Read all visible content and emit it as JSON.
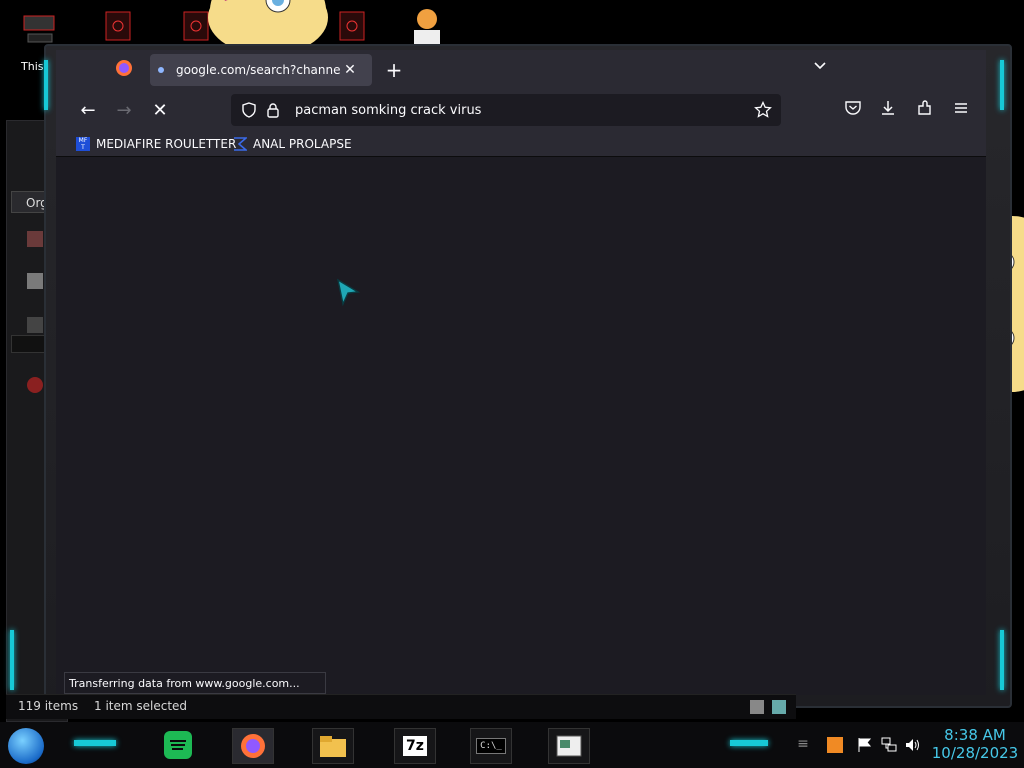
{
  "desktop": {
    "icon_label": "This"
  },
  "browser": {
    "tab": {
      "title": "google.com/search?channel=fs",
      "close_glyph": "✕"
    },
    "newtab_glyph": "+",
    "tablist_glyph": "⌄",
    "nav": {
      "back_glyph": "←",
      "forward_glyph": "→",
      "stop_glyph": "✕"
    },
    "url": "pacman somking crack virus",
    "toolbar_icons": [
      "star-icon",
      "pocket-icon",
      "download-icon",
      "extensions-icon",
      "menu-icon"
    ],
    "bookmarks": [
      {
        "label": "MEDIAFIRE ROULETTER",
        "icon": "MF T"
      },
      {
        "label": "ANAL PROLAPSE",
        "icon": "sigma"
      }
    ],
    "status": "Transferring data from www.google.com..."
  },
  "explorer": {
    "tab_label": "Orga",
    "items_count": "119 items",
    "selected": "1 item selected"
  },
  "taskbar": {
    "clock_time": "8:38 AM",
    "clock_date": "10/28/2023",
    "seven_zip_label": "7z",
    "cmd_label": "C:\\_"
  },
  "colors": {
    "accent_cyan": "#17c9d6",
    "browser_bg": "#1c1b22",
    "toolbar_bg": "#2b2a33",
    "clock": "#46c8e8"
  }
}
